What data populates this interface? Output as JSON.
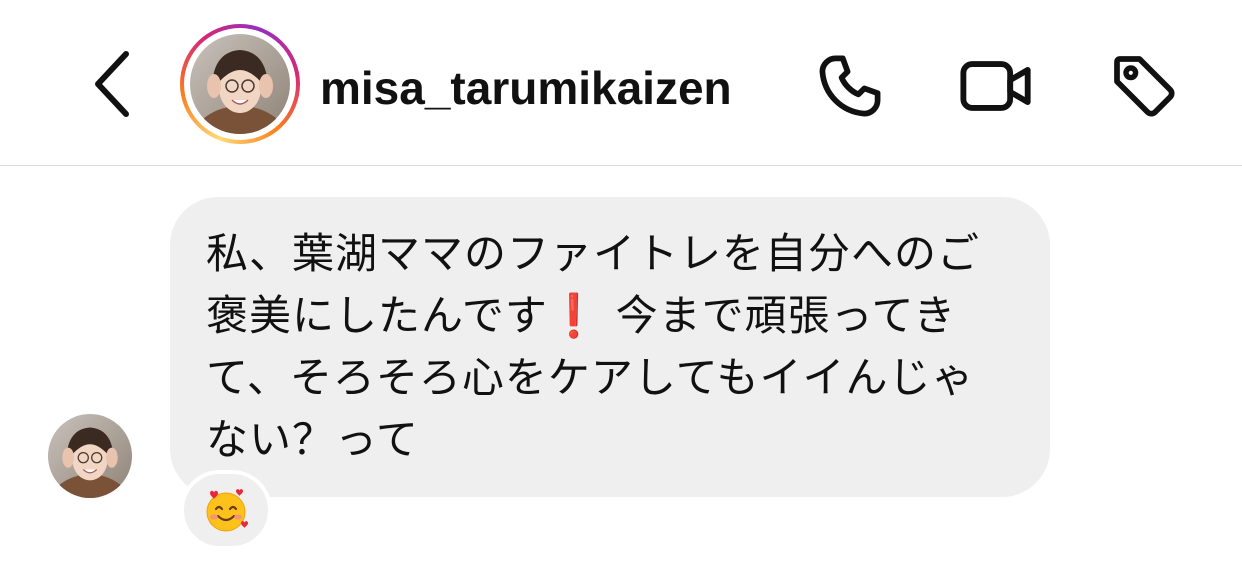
{
  "header": {
    "username": "misa_tarumikaizen",
    "back_icon": "chevron-left-icon",
    "call_icon": "phone-icon",
    "video_icon": "video-camera-icon",
    "tag_icon": "tag-icon"
  },
  "message": {
    "lines": [
      "私、葉湖ママのファイトレを自分へのご",
      "褒美にしたんです",
      "今まで頑張ってき",
      "て、そろそろ心をケアしてもイイんじゃ",
      "ない？って"
    ],
    "exclamation_emoji": "❗",
    "reaction_emoji": "🥰"
  },
  "colors": {
    "bubble": "#efefef",
    "text": "#111111",
    "divider": "#dcdcdc",
    "exclamation": "#e0162b"
  }
}
